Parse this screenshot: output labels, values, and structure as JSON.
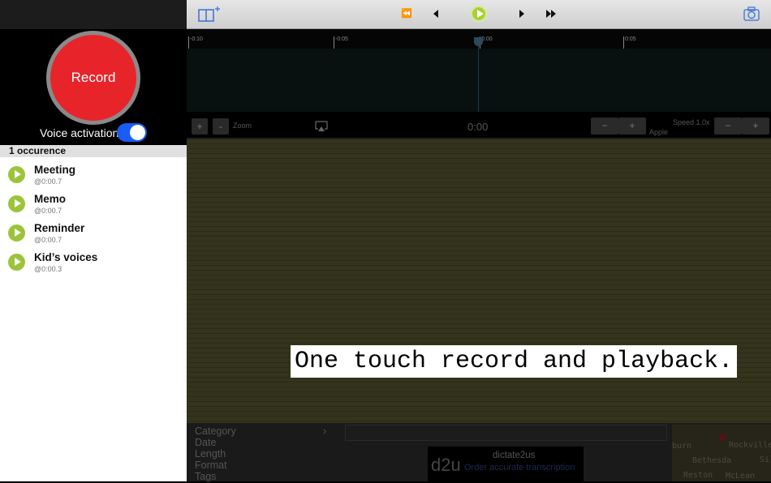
{
  "sidebar": {
    "record_label": "Record",
    "voice_activation_label": "Voice activation",
    "voice_activation_on": true,
    "occurrence_header": "1 occurence",
    "items": [
      {
        "name": "Meeting",
        "time": "@0:00.7"
      },
      {
        "name": "Memo",
        "time": "@0:00.7"
      },
      {
        "name": "Reminder",
        "time": "@0:00.7"
      },
      {
        "name": "Kid’s voices",
        "time": "@0:00.3"
      }
    ]
  },
  "toolbar": {
    "rewind": "⏪",
    "prev": "◀",
    "next": "▶",
    "forward": "⏩"
  },
  "ruler": {
    "ticks": [
      "-0:10",
      "-0:05",
      "0:00",
      "0:05"
    ]
  },
  "controls": {
    "zoom_label": "Zoom",
    "plus": "+",
    "minus": "-",
    "time": "0:00",
    "speed_label": "Speed 1.0x",
    "voice_label": "Apple",
    "minus2": "−",
    "plus2": "+"
  },
  "caption": "One touch record and playback.",
  "details": {
    "fields": [
      "Category",
      "Date",
      "Length",
      "Format",
      "Tags"
    ],
    "chevron": "›"
  },
  "ad": {
    "logo": "d2u",
    "title": "dictate2us",
    "subtitle": "Order accurate transcription"
  },
  "map": {
    "labels": [
      "Rockville",
      "Bethesda",
      "Reston",
      "McLean",
      "burn",
      "Sil"
    ]
  },
  "colors": {
    "record": "#e8242b",
    "play": "#9cc43a",
    "toggle": "#1a5cf6",
    "accent": "#3a6fd8"
  }
}
